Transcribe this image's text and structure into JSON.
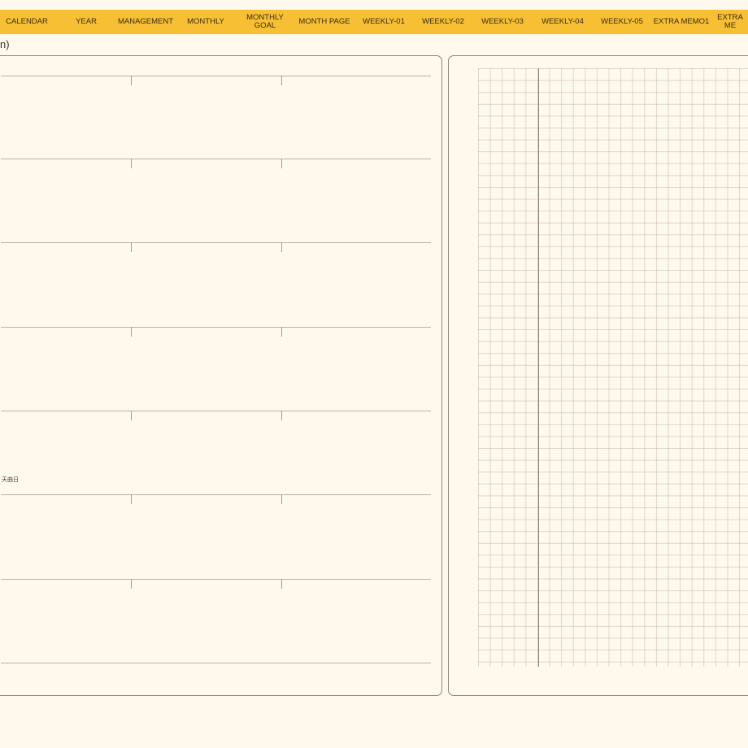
{
  "tabs": [
    {
      "label": "CALENDAR"
    },
    {
      "label": "YEAR"
    },
    {
      "label": "MANAGEMENT"
    },
    {
      "label": "MONTHLY"
    },
    {
      "label": "MONTHLY\nGOAL"
    },
    {
      "label": "MONTH PAGE"
    },
    {
      "label": "WEEKLY-01"
    },
    {
      "label": "WEEKLY-02"
    },
    {
      "label": "WEEKLY-03"
    },
    {
      "label": "WEEKLY-04"
    },
    {
      "label": "WEEKLY-05"
    },
    {
      "label": "EXTRA MEMO1"
    },
    {
      "label": "EXTRA ME"
    }
  ],
  "header_note": "n)",
  "left_note": "天曲日",
  "colors": {
    "tab_bar": "#f7bf34",
    "page_background": "#fff8ec",
    "panel_border": "#8e8576"
  }
}
